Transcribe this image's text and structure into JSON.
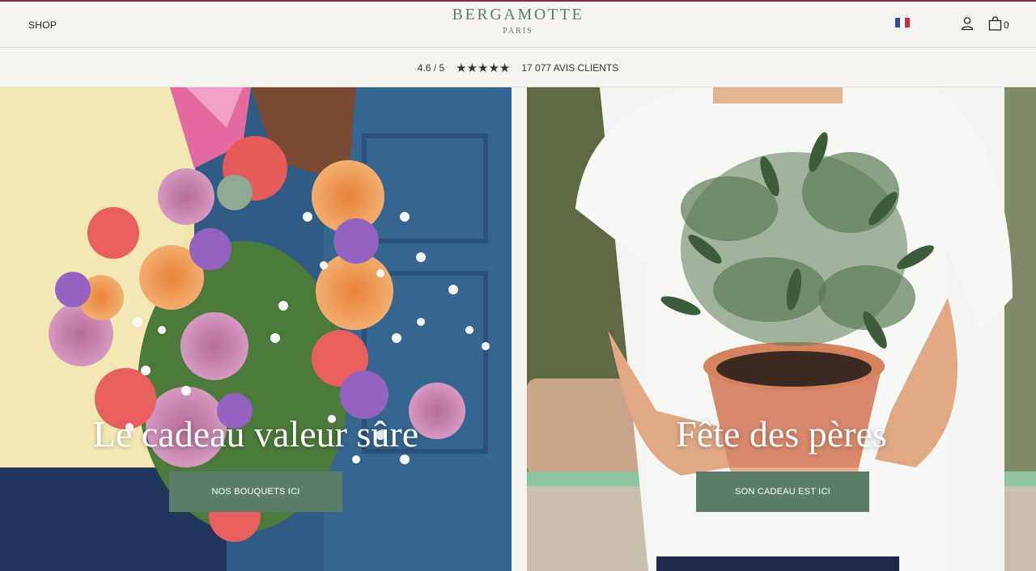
{
  "header": {
    "shop_label": "SHOP",
    "logo_name": "BERGAMOTTE",
    "logo_city": "PARIS",
    "language_icon": "french-flag-icon",
    "account_icon": "user-icon",
    "cart_icon": "shopping-bag-icon",
    "cart_count": "0"
  },
  "rating": {
    "score": "4.6 / 5",
    "stars_glyph": "★★★★★",
    "reviews": "17 077 AVIS CLIENTS"
  },
  "heroes": [
    {
      "title": "Le cadeau valeur sûre",
      "cta": "NOS BOUQUETS ICI"
    },
    {
      "title": "Fête des pères",
      "cta": "SON CADEAU EST ICI"
    }
  ],
  "colors": {
    "brand_green": "#5b7d69",
    "logo_green": "#5c7d6a",
    "accent_top_line": "#8a2b3c",
    "background": "#f6f4f0"
  }
}
